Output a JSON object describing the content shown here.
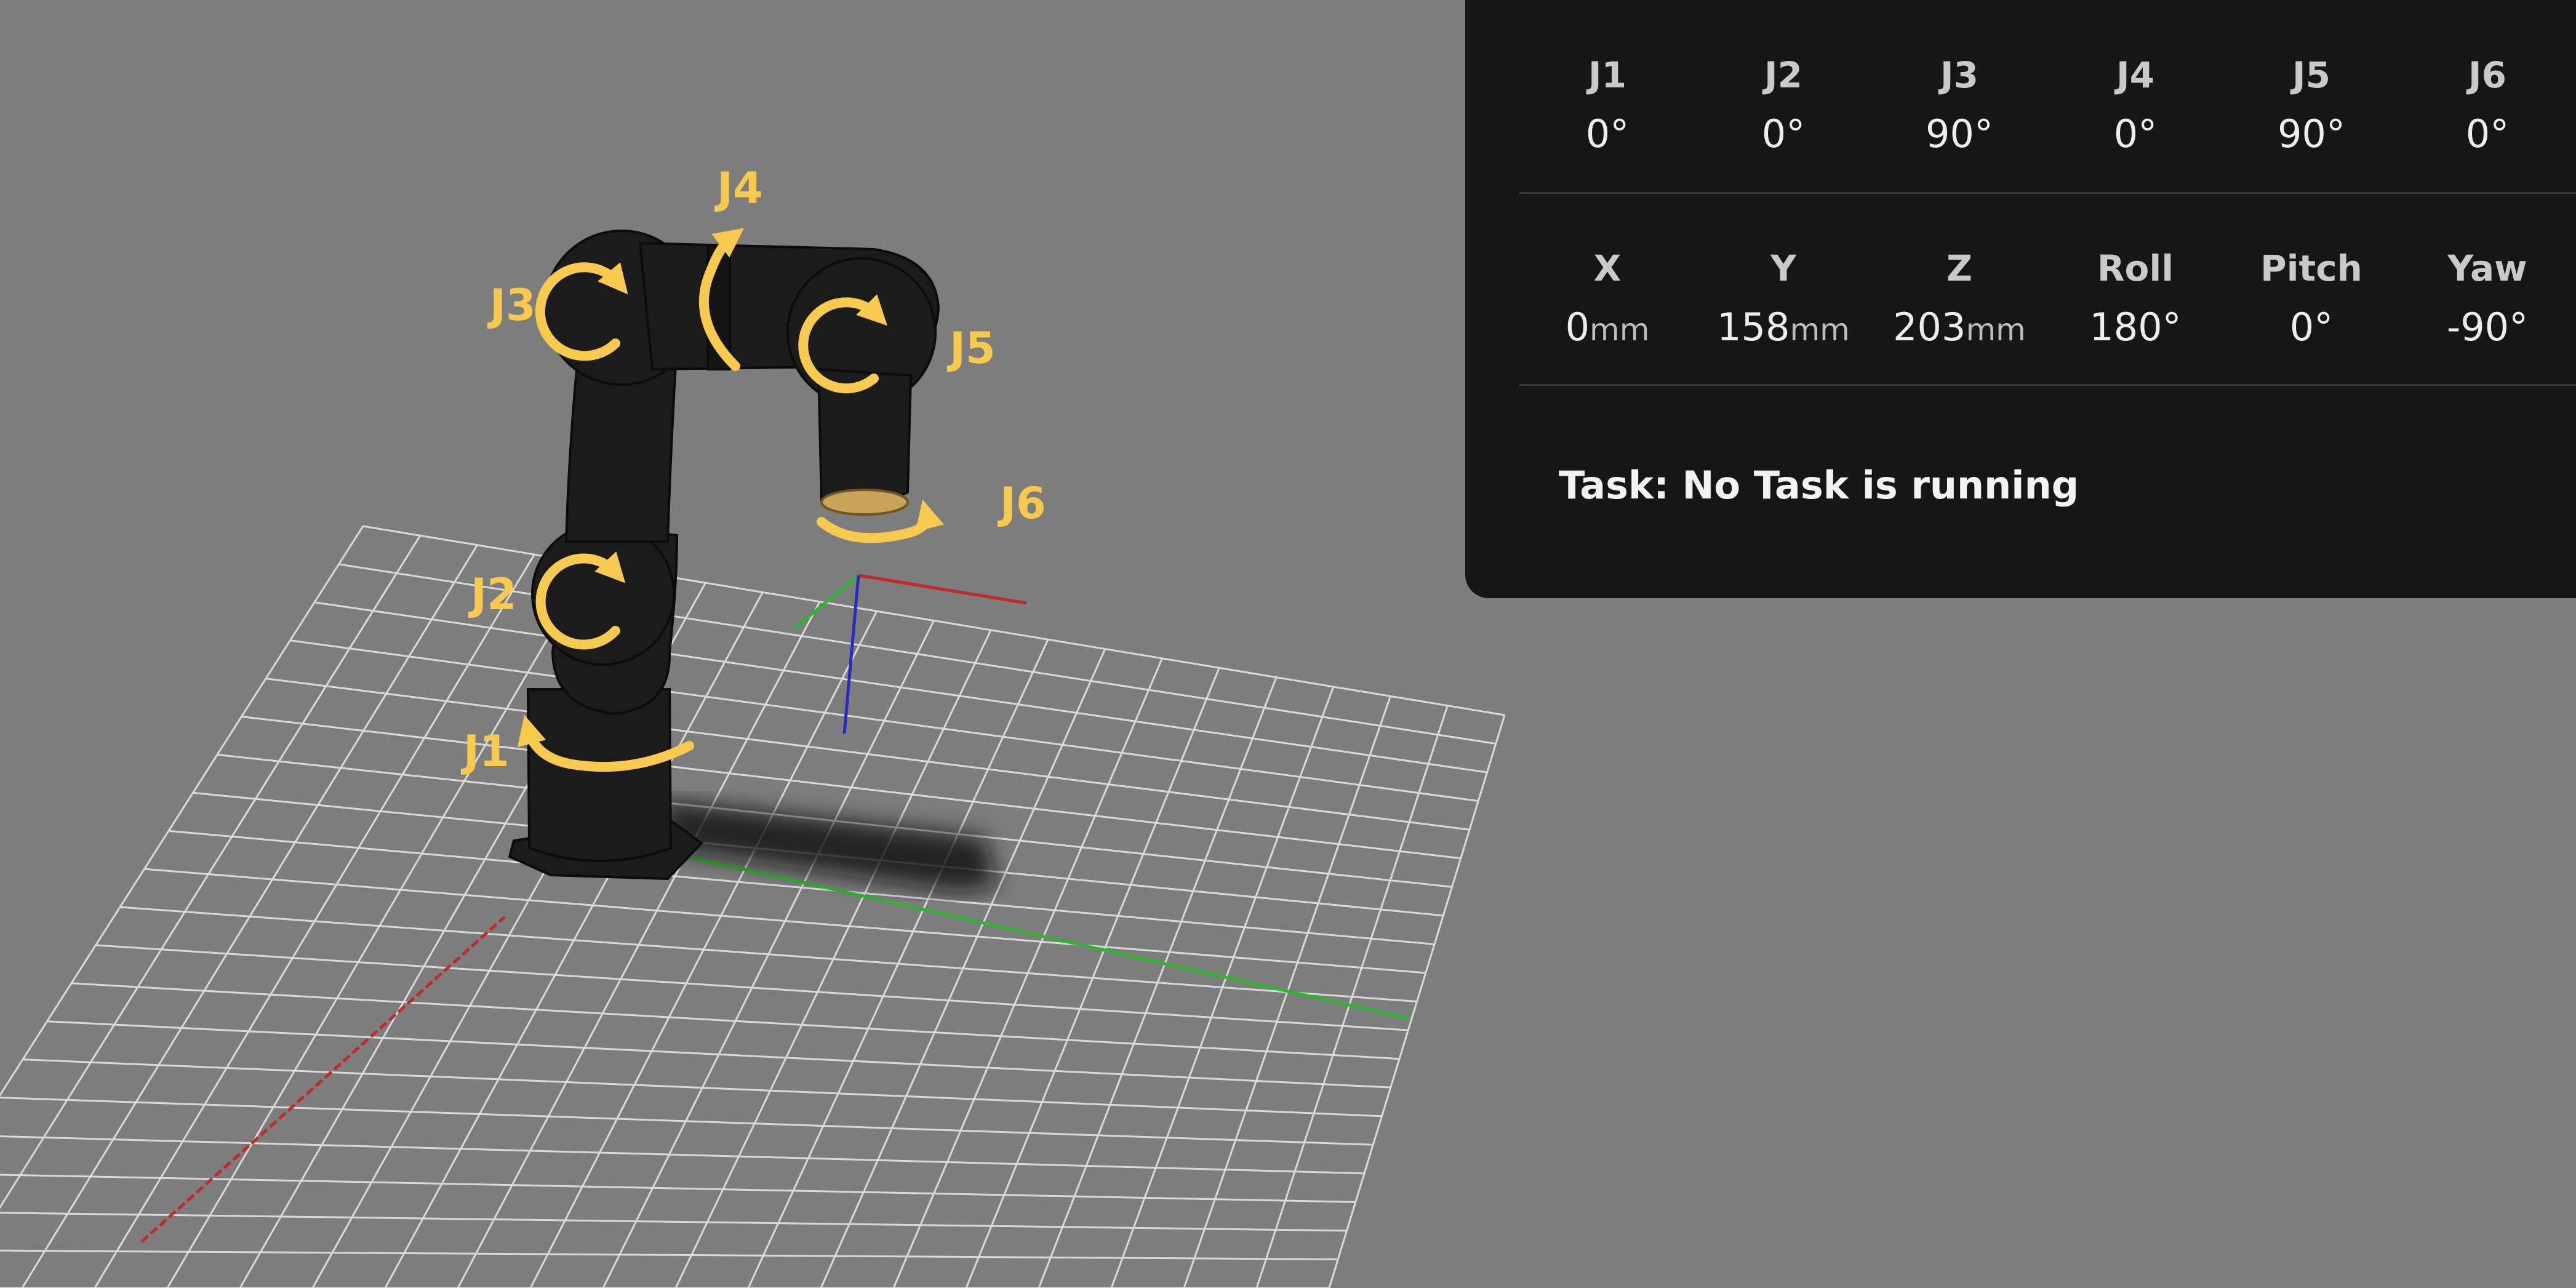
{
  "scene": {
    "joint_labels": {
      "j1": "J1",
      "j2": "J2",
      "j3": "J3",
      "j4": "J4",
      "j5": "J5",
      "j6": "J6"
    },
    "colors": {
      "background": "#7d7d7d",
      "grid": "#d9d9d9",
      "robot": "#1b1b1b",
      "annotation": "#f7c94f",
      "axis_x": "#c22a2a",
      "axis_y": "#2fb52f",
      "axis_z": "#2a2ac2"
    },
    "icons": [
      "rotation-arrow-icon"
    ]
  },
  "panel": {
    "joints": [
      {
        "label": "J1",
        "value": "0°"
      },
      {
        "label": "J2",
        "value": "0°"
      },
      {
        "label": "J3",
        "value": "90°"
      },
      {
        "label": "J4",
        "value": "0°"
      },
      {
        "label": "J5",
        "value": "90°"
      },
      {
        "label": "J6",
        "value": "0°"
      }
    ],
    "pose": [
      {
        "label": "X",
        "value": "0",
        "unit": "mm"
      },
      {
        "label": "Y",
        "value": "158",
        "unit": "mm"
      },
      {
        "label": "Z",
        "value": "203",
        "unit": "mm"
      },
      {
        "label": "Roll",
        "value": "180°",
        "unit": ""
      },
      {
        "label": "Pitch",
        "value": "0°",
        "unit": ""
      },
      {
        "label": "Yaw",
        "value": "-90°",
        "unit": ""
      }
    ],
    "task_text": "Task: No Task is running"
  }
}
